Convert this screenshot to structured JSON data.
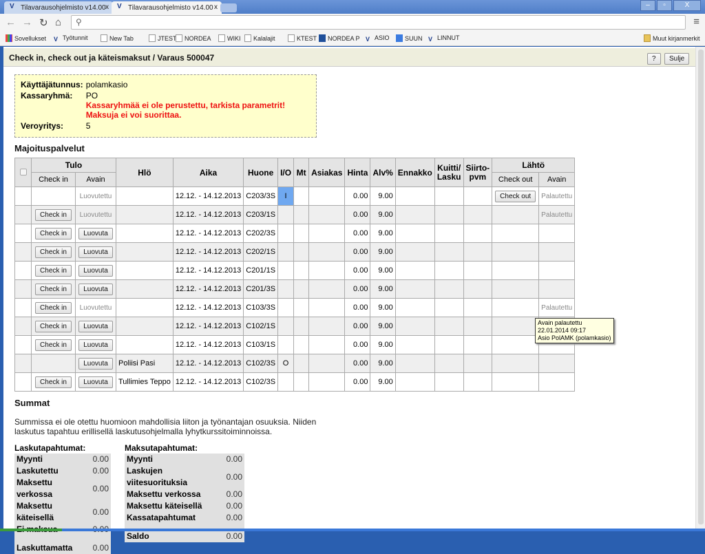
{
  "browser": {
    "tabs": [
      {
        "label": "Tilavarausohjelmisto v14.00"
      },
      {
        "label": "Tilavarausohjelmisto v14.00"
      }
    ],
    "close_glyph": "x",
    "address": "",
    "bookmarks": [
      {
        "label": "Sovellukset",
        "icon": "apps-icon"
      },
      {
        "label": "Työtunnit",
        "icon": "v-logo-icon"
      },
      {
        "label": "New Tab",
        "icon": "page-icon"
      },
      {
        "label": "JTEST",
        "icon": "page-icon"
      },
      {
        "label": "NORDEA",
        "icon": "page-icon"
      },
      {
        "label": "WIKI",
        "icon": "page-icon"
      },
      {
        "label": "Kalalajit",
        "icon": "page-icon"
      },
      {
        "label": "KTEST",
        "icon": "page-icon"
      },
      {
        "label": "NORDEA P",
        "icon": "nordea-icon"
      },
      {
        "label": "ASIO",
        "icon": "v-logo-icon"
      },
      {
        "label": "SUUN",
        "icon": "google-icon"
      },
      {
        "label": "LINNUT",
        "icon": "v-logo-icon"
      }
    ],
    "other_bookmarks": "Muut kirjanmerkit"
  },
  "header": {
    "title": "Check in, check out ja käteismaksut / Varaus 500047",
    "help_label": "?",
    "close_label": "Sulje"
  },
  "info": {
    "user_label": "Käyttäjätunnus:",
    "user": "polamkasio",
    "group_label": "Kassaryhmä:",
    "group": "PO",
    "error": "Kassaryhmää ei ole perustettu, tarkista parametrit! Maksuja ei voi suorittaa.",
    "tax_label": "Veroyritys:",
    "tax": "5"
  },
  "section_title": "Majoituspalvelut",
  "table": {
    "headers": {
      "tulo": "Tulo",
      "checkin": "Check in",
      "avain": "Avain",
      "hlo": "Hlö",
      "aika": "Aika",
      "huone": "Huone",
      "io": "I/O",
      "mt": "Mt",
      "asiakas": "Asiakas",
      "hinta": "Hinta",
      "alv": "Alv%",
      "ennakko": "Ennakko",
      "kuitti": "Kuitti/ Lasku",
      "siirto": "Siirto- pvm",
      "lahto": "Lähtö",
      "checkout": "Check out",
      "avain2": "Avain"
    },
    "rows": [
      {
        "checkin": "",
        "key": "Luovutettu",
        "person": "",
        "time": "12.12. - 14.12.2013",
        "room": "C203/3S",
        "io": "I",
        "io_selected": true,
        "price": "0.00",
        "vat": "9.00",
        "checkout": "Check out",
        "key_return": "Palautettu"
      },
      {
        "checkin": "Check in",
        "key": "Luovutettu",
        "person": "",
        "time": "12.12. - 14.12.2013",
        "room": "C203/1S",
        "io": "",
        "price": "0.00",
        "vat": "9.00",
        "checkout": "",
        "key_return": "Palautettu"
      },
      {
        "checkin": "Check in",
        "key": "Luovuta",
        "person": "",
        "time": "12.12. - 14.12.2013",
        "room": "C202/3S",
        "io": "",
        "price": "0.00",
        "vat": "9.00",
        "checkout": "",
        "key_return": ""
      },
      {
        "checkin": "Check in",
        "key": "Luovuta",
        "person": "",
        "time": "12.12. - 14.12.2013",
        "room": "C202/1S",
        "io": "",
        "price": "0.00",
        "vat": "9.00",
        "checkout": "",
        "key_return": ""
      },
      {
        "checkin": "Check in",
        "key": "Luovuta",
        "person": "",
        "time": "12.12. - 14.12.2013",
        "room": "C201/1S",
        "io": "",
        "price": "0.00",
        "vat": "9.00",
        "checkout": "",
        "key_return": ""
      },
      {
        "checkin": "Check in",
        "key": "Luovuta",
        "person": "",
        "time": "12.12. - 14.12.2013",
        "room": "C201/3S",
        "io": "",
        "price": "0.00",
        "vat": "9.00",
        "checkout": "",
        "key_return": ""
      },
      {
        "checkin": "Check in",
        "key": "Luovutettu",
        "person": "",
        "time": "12.12. - 14.12.2013",
        "room": "C103/3S",
        "io": "",
        "price": "0.00",
        "vat": "9.00",
        "checkout": "",
        "key_return": "Palautettu"
      },
      {
        "checkin": "Check in",
        "key": "Luovuta",
        "person": "",
        "time": "12.12. - 14.12.2013",
        "room": "C102/1S",
        "io": "",
        "price": "0.00",
        "vat": "9.00",
        "checkout": "",
        "key_return": ""
      },
      {
        "checkin": "Check in",
        "key": "Luovuta",
        "person": "",
        "time": "12.12. - 14.12.2013",
        "room": "C103/1S",
        "io": "",
        "price": "0.00",
        "vat": "9.00",
        "checkout": "",
        "key_return": ""
      },
      {
        "checkin": "",
        "key": "Luovuta",
        "person": "Poliisi Pasi",
        "time": "12.12. - 14.12.2013",
        "room": "C102/3S",
        "io": "O",
        "price": "0.00",
        "vat": "9.00",
        "checkout": "",
        "key_return": ""
      },
      {
        "checkin": "Check in",
        "key": "Luovuta",
        "person": "Tullimies Teppo",
        "time": "12.12. - 14.12.2013",
        "room": "C102/3S",
        "io": "",
        "price": "0.00",
        "vat": "9.00",
        "checkout": "",
        "key_return": ""
      }
    ]
  },
  "tooltip": {
    "line1": "Avain palautettu",
    "line2": "22.01.2014 09:17",
    "line3": "Asio PolAMK (polamkasio)"
  },
  "sums": {
    "title": "Summat",
    "note": "Summissa ei ole otettu huomioon mahdollisia liiton ja työnantajan osuuksia. Niiden laskutus tapahtuu erillisellä laskutusohjelmalla lyhytkurssitoiminnoissa.",
    "invoice": {
      "title": "Laskutapahtumat:",
      "rows": [
        {
          "label": "Myynti",
          "value": "0.00"
        },
        {
          "label": "Laskutettu",
          "value": "0.00"
        },
        {
          "label": "Maksettu verkossa",
          "value": "0.00"
        },
        {
          "label": "Maksettu käteisellä",
          "value": "0.00"
        },
        {
          "label": "Ei maksua",
          "value": "0.00"
        },
        {
          "label": "",
          "value": ""
        },
        {
          "label": "Laskuttamatta",
          "value": "0.00"
        }
      ]
    },
    "payment": {
      "title": "Maksutapahtumat:",
      "rows": [
        {
          "label": "Myynti",
          "value": "0.00"
        },
        {
          "label": "Laskujen viitesuorituksia",
          "value": "0.00"
        },
        {
          "label": "Maksettu verkossa",
          "value": "0.00"
        },
        {
          "label": "Maksettu käteisellä",
          "value": "0.00"
        },
        {
          "label": "Kassatapahtumat",
          "value": "0.00"
        },
        {
          "label": "",
          "value": ""
        },
        {
          "label": "Saldo",
          "value": "0.00"
        }
      ]
    }
  }
}
